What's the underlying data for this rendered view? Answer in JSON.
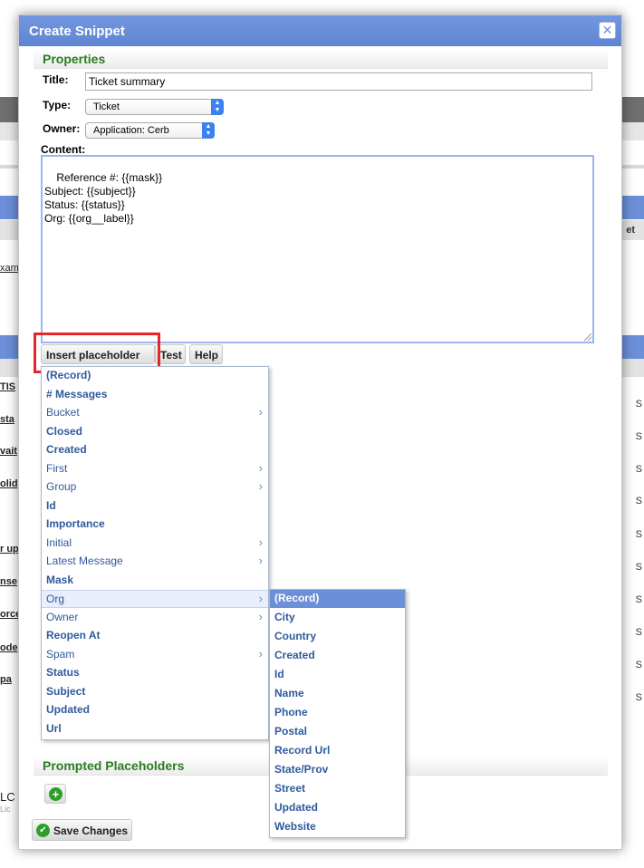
{
  "dialog": {
    "title": "Create Snippet",
    "close_icon": "close-icon",
    "properties_heading": "Properties",
    "title_label": "Title:",
    "title_value": "Ticket summary",
    "type_label": "Type:",
    "type_value": "Ticket",
    "owner_label": "Owner:",
    "owner_value": "Application: Cerb",
    "content_label": "Content:",
    "content_value": "Reference #: {{mask}}\nSubject: {{subject}}\nStatus: {{status}}\nOrg: {{org__label}}",
    "insert_placeholder_label": "Insert placeholder",
    "test_label": "Test",
    "help_label": "Help",
    "prompted_heading": "Prompted Placeholders",
    "save_label": "Save Changes"
  },
  "placeholder_menu": [
    {
      "label": "(Record)",
      "bold": true
    },
    {
      "label": "# Messages",
      "bold": true
    },
    {
      "label": "Bucket",
      "bold": false,
      "submenu": true
    },
    {
      "label": "Closed",
      "bold": true
    },
    {
      "label": "Created",
      "bold": true
    },
    {
      "label": "First",
      "bold": false,
      "submenu": true
    },
    {
      "label": "Group",
      "bold": false,
      "submenu": true
    },
    {
      "label": "Id",
      "bold": true
    },
    {
      "label": "Importance",
      "bold": true
    },
    {
      "label": "Initial",
      "bold": false,
      "submenu": true
    },
    {
      "label": "Latest Message",
      "bold": false,
      "submenu": true
    },
    {
      "label": "Mask",
      "bold": true
    },
    {
      "label": "Org",
      "bold": false,
      "submenu": true,
      "selected": true
    },
    {
      "label": "Owner",
      "bold": false,
      "submenu": true
    },
    {
      "label": "Reopen At",
      "bold": true
    },
    {
      "label": "Spam",
      "bold": false,
      "submenu": true
    },
    {
      "label": "Status",
      "bold": true
    },
    {
      "label": "Subject",
      "bold": true
    },
    {
      "label": "Updated",
      "bold": true
    },
    {
      "label": "Url",
      "bold": true
    }
  ],
  "org_submenu": [
    {
      "label": "(Record)",
      "active": true
    },
    {
      "label": "City"
    },
    {
      "label": "Country"
    },
    {
      "label": "Created"
    },
    {
      "label": "Id"
    },
    {
      "label": "Name"
    },
    {
      "label": "Phone"
    },
    {
      "label": "Postal"
    },
    {
      "label": "Record Url"
    },
    {
      "label": "State/Prov"
    },
    {
      "label": "Street"
    },
    {
      "label": "Updated"
    },
    {
      "label": "Website"
    }
  ],
  "background": {
    "frags": [
      "xam",
      "TIS",
      "sta",
      "vait",
      "olid",
      "r up",
      "nse",
      "orce",
      "ode",
      "pa",
      "LC",
      "Lic"
    ],
    "right_header": "et",
    "right_s": "S"
  },
  "colors": {
    "titlebar": "#6b8fd8",
    "section_heading": "#2a7d1f",
    "menu_text": "#2f5a9c",
    "highlight": "#e8262a"
  }
}
